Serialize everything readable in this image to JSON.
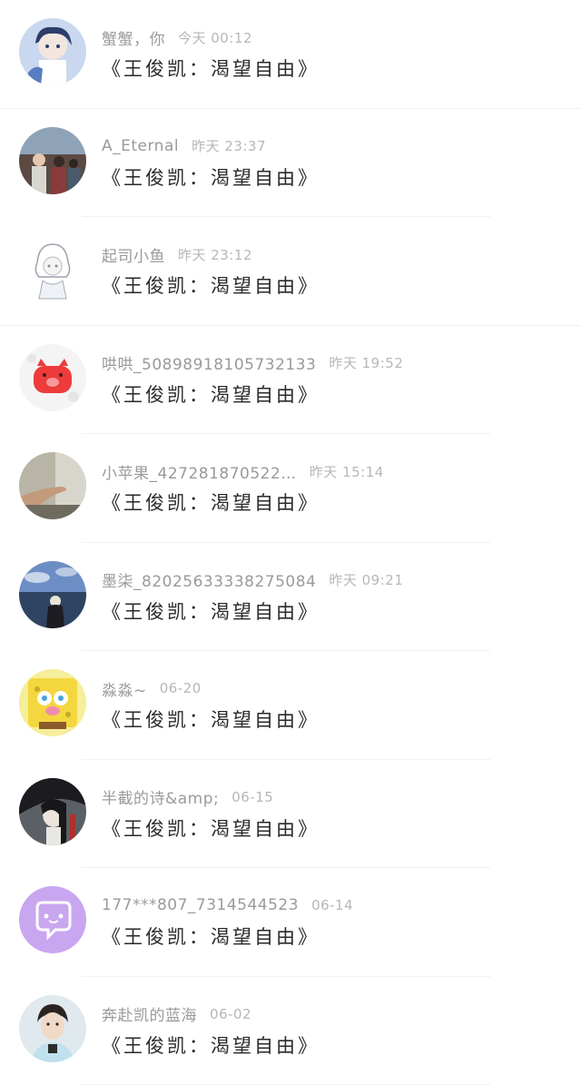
{
  "comments": [
    {
      "name": "蟹蟹，你",
      "time": "今天 00:12",
      "message": "《王俊凯：渴望自由》",
      "avatar": "anime-boy-avatar"
    },
    {
      "name": "A_Eternal",
      "time": "昨天 23:37",
      "message": "《王俊凯：渴望自由》",
      "avatar": "beach-photo-avatar"
    },
    {
      "name": "起司小鱼",
      "time": "昨天 23:12",
      "message": "《王俊凯：渴望自由》",
      "avatar": "sketch-girl-avatar"
    },
    {
      "name": "哄哄_50898918105732133",
      "time": "昨天 19:52",
      "message": "《王俊凯：渴望自由》",
      "avatar": "red-pig-avatar"
    },
    {
      "name": "小苹果_427281870522…",
      "time": "昨天 15:14",
      "message": "《王俊凯：渴望自由》",
      "avatar": "hand-photo-avatar"
    },
    {
      "name": "墨柒_82025633338275084",
      "time": "昨天 09:21",
      "message": "《王俊凯：渴望自由》",
      "avatar": "seaside-figure-avatar"
    },
    {
      "name": "淼淼~",
      "time": "06-20",
      "message": "《王俊凯：渴望自由》",
      "avatar": "spongebob-avatar"
    },
    {
      "name": "半截的诗&amp;",
      "time": "06-15",
      "message": "《王俊凯：渴望自由》",
      "avatar": "dark-hair-photo-avatar"
    },
    {
      "name": "177***807_7314544523",
      "time": "06-14",
      "message": "《王俊凯：渴望自由》",
      "avatar": "purple-chat-avatar"
    },
    {
      "name": "奔赴凯的蓝海",
      "time": "06-02",
      "message": "《王俊凯：渴望自由》",
      "avatar": "boy-portrait-avatar"
    }
  ],
  "colors": {
    "name": "#9a9a9a",
    "time": "#b7b7b7",
    "message": "#2a2a2a",
    "divider": "#f1f1f1"
  }
}
